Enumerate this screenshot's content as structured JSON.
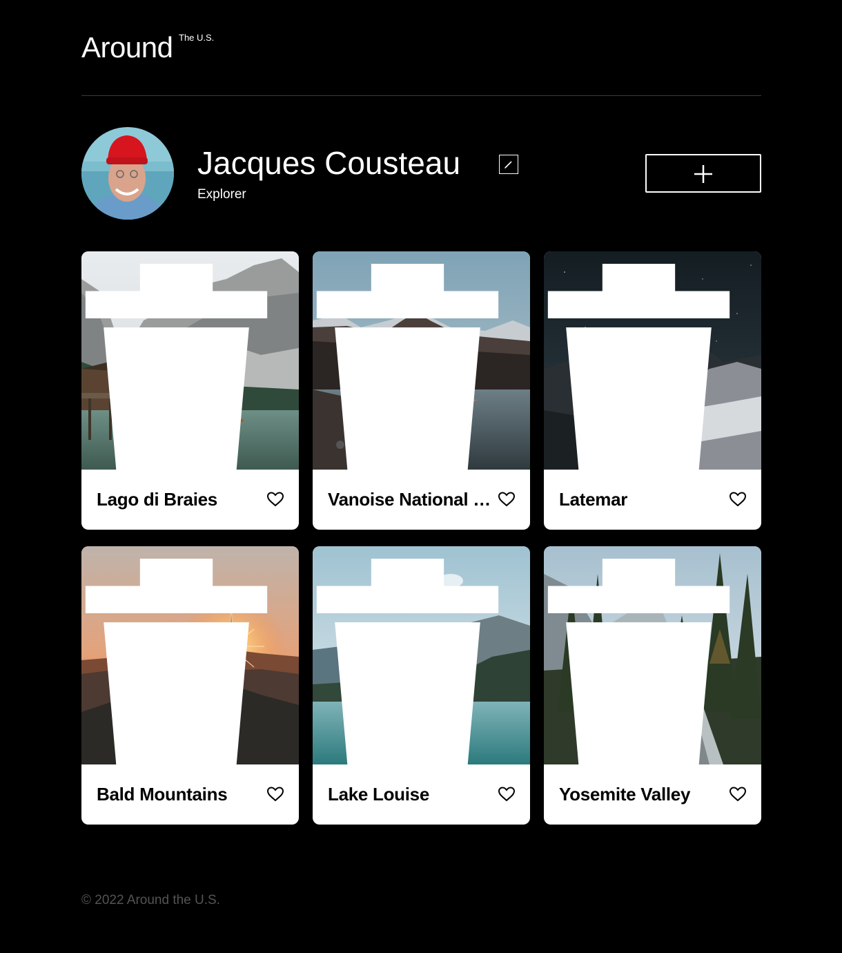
{
  "header": {
    "logo_main": "Around",
    "logo_sup": "The U.S."
  },
  "profile": {
    "name": "Jacques Cousteau",
    "about": "Explorer"
  },
  "cards": [
    {
      "title": "Lago di Braies"
    },
    {
      "title": "Vanoise National Park"
    },
    {
      "title": "Latemar"
    },
    {
      "title": "Bald Mountains"
    },
    {
      "title": "Lake Louise"
    },
    {
      "title": "Yosemite Valley"
    }
  ],
  "footer": {
    "copyright": "© 2022 Around the U.S."
  },
  "colors": {
    "background": "#000000",
    "text": "#ffffff",
    "card": "#ffffff",
    "footer_text": "#545454"
  }
}
